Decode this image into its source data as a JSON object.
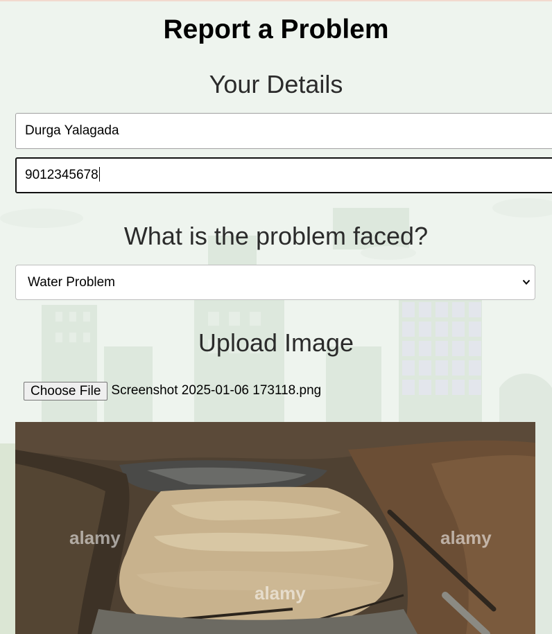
{
  "page": {
    "title": "Report a Problem"
  },
  "details": {
    "heading": "Your Details",
    "name_value": "Durga Yalagada",
    "phone_value": "9012345678"
  },
  "problem": {
    "heading": "What is the problem faced?",
    "selected_option": "Water Problem"
  },
  "upload": {
    "heading": "Upload Image",
    "choose_file_label": "Choose File",
    "file_name": "Screenshot 2025-01-06 173118.png",
    "watermark": "alamy"
  },
  "icons": {
    "select_arrow": "chevron-down-icon"
  },
  "colors": {
    "background": "#eef4ee",
    "title": "#000000",
    "heading": "#2b2b2b",
    "focused_border": "#111111"
  }
}
